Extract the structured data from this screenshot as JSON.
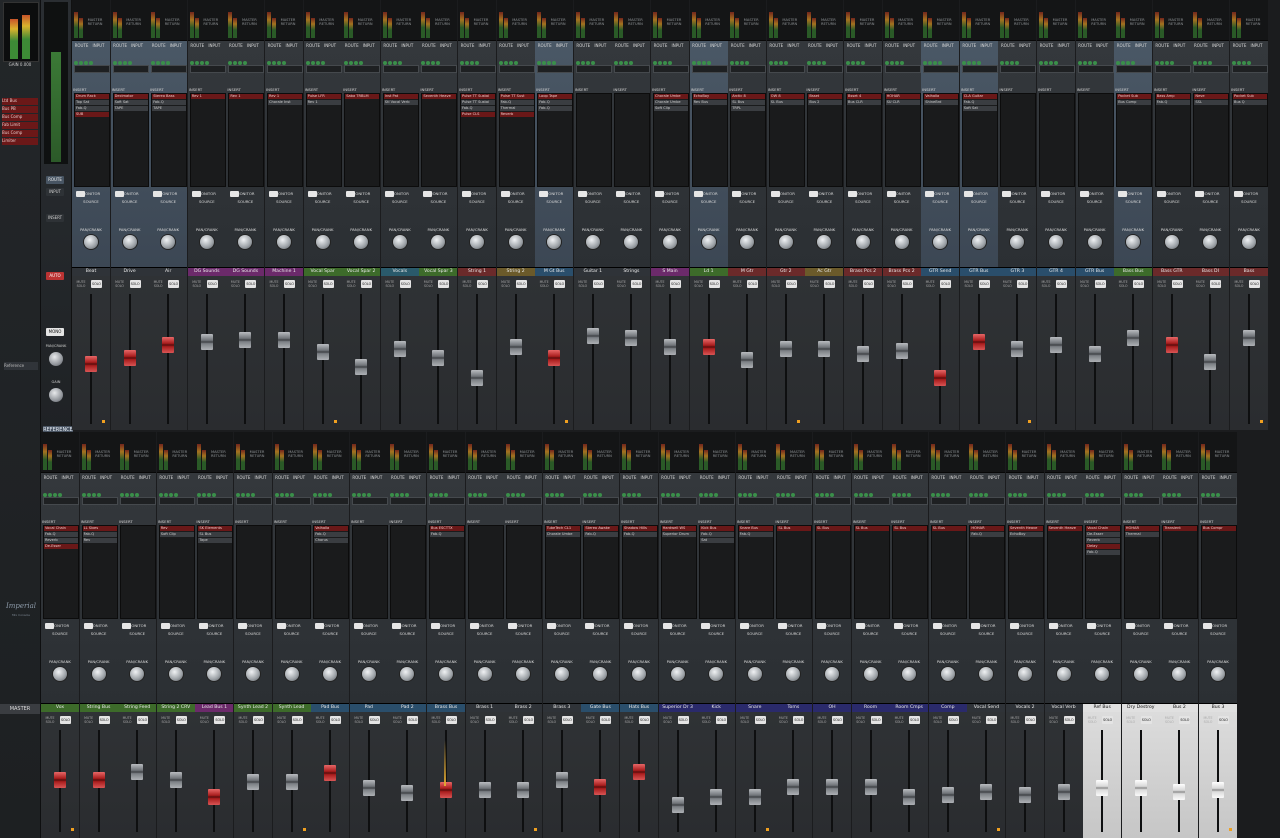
{
  "master": {
    "meter_labels": [
      "RMS",
      "AD"
    ],
    "gain_readout": "GAIN 0.000",
    "inserts": [
      "Ltd Bus",
      "Bus PB",
      "Bus Comp",
      "Fab Limit",
      "Bus Comp",
      "Limiter"
    ],
    "reference_text": "Reference",
    "label": "MASTER",
    "reference_tab": "REFERENCE"
  },
  "mid": {
    "buttons": [
      "ROUTE",
      "INPUT",
      "INSERT",
      "AUTO",
      "MONO"
    ],
    "pan_label": "PAN/CRANK",
    "gain_label": "GAIN"
  },
  "strip_labels": {
    "route": "ROUTE",
    "input": "INPUT",
    "insert": "INSERT",
    "monitor": "MONITOR",
    "source": "SOURCE",
    "pan": "PAN/CRANK",
    "solo": "SOLO",
    "mute": "MUTE SOLO",
    "master_return": "MASTER RETURN"
  },
  "top_tracks": [
    {
      "name": "Beat",
      "color": "#2f3338",
      "inserts": [
        "Drum Rack",
        "Top Sat",
        "Fab-Q",
        "SUB"
      ],
      "fader": "red",
      "fpos": 0.55,
      "blue": true
    },
    {
      "name": "Drive",
      "color": "#2f3338",
      "inserts": [
        "Decimator",
        "Soft Sat",
        "TAPE"
      ],
      "fader": "red",
      "fpos": 0.5,
      "blue": true
    },
    {
      "name": "Air",
      "color": "#2f3338",
      "inserts": [
        "Stereo Bass",
        "Fab-Q",
        "TAPE"
      ],
      "fader": "red",
      "fpos": 0.38,
      "blue": true
    },
    {
      "name": "DG Sounds",
      "color": "#6b2a6a",
      "inserts": [
        "Rev 1"
      ],
      "fader": "grey",
      "fpos": 0.36
    },
    {
      "name": "DG Sounds",
      "color": "#6b2a6a",
      "inserts": [
        "Rev 1"
      ],
      "fader": "grey",
      "fpos": 0.34
    },
    {
      "name": "Machine 1",
      "color": "#6b2a6a",
      "inserts": [
        "Rev 1",
        "Chorale Inst"
      ],
      "fader": "grey",
      "fpos": 0.34
    },
    {
      "name": "Vocal Spar",
      "color": "#3d6b2a",
      "inserts": [
        "Pulse LFR",
        "Rev 1"
      ],
      "fader": "grey",
      "fpos": 0.45
    },
    {
      "name": "Vocal Spar 2",
      "color": "#3d6b2a",
      "inserts": [
        "Saba TRBLM"
      ],
      "fader": "grey",
      "fpos": 0.58
    },
    {
      "name": "Vocals",
      "color": "#2a5a6b",
      "inserts": [
        "Inst Pat",
        "Stl Vocal Verb"
      ],
      "fader": "grey",
      "fpos": 0.42
    },
    {
      "name": "Vocal Spar 3",
      "color": "#3d6b2a",
      "inserts": [
        "Seventh Heave"
      ],
      "fader": "grey",
      "fpos": 0.5
    },
    {
      "name": "String 1",
      "color": "#6b2a2a",
      "inserts": [
        "Pulse TT Sustai",
        "Pulse TT Sustai",
        "Fab-Q",
        "Pulse CLS"
      ],
      "fader": "grey",
      "fpos": 0.68
    },
    {
      "name": "String 2",
      "color": "#6b5a2a",
      "inserts": [
        "Pulse TT Sust",
        "Fab-Q",
        "Thermal",
        "Reverb"
      ],
      "fader": "grey",
      "fpos": 0.4
    },
    {
      "name": "M Gt Bus",
      "color": "#2a4e6b",
      "inserts": [
        "Loop Tape",
        "Fab-Q",
        "Fab-Q"
      ],
      "fader": "red",
      "fpos": 0.5,
      "blue": true
    },
    {
      "name": "Guitar 1",
      "color": "#2f3338",
      "inserts": [],
      "fader": "grey",
      "fpos": 0.3
    },
    {
      "name": "Strings",
      "color": "#2f3338",
      "inserts": [],
      "fader": "grey",
      "fpos": 0.32
    },
    {
      "name": "S Main",
      "color": "#6b2a6a",
      "inserts": [
        "Chorale Umbe",
        "Chorale Umbe",
        "Soft Clip"
      ],
      "fader": "grey",
      "fpos": 0.4
    },
    {
      "name": "Ld 1",
      "color": "#3d6b2a",
      "inserts": [
        "EchoBoy",
        "Rev Bus"
      ],
      "fader": "red",
      "fpos": 0.4,
      "blue": true
    },
    {
      "name": "M Gtr",
      "color": "#6b2a2a",
      "inserts": [
        "Arctic 8",
        "SL Bus",
        "TRPL"
      ],
      "fader": "grey",
      "fpos": 0.52
    },
    {
      "name": "Gtr 2",
      "color": "#6b2a2a",
      "inserts": [
        "OW 8",
        "SL Bus"
      ],
      "fader": "grey",
      "fpos": 0.42
    },
    {
      "name": "Ac Gtr",
      "color": "#6b5a2a",
      "inserts": [
        "Bsset",
        "Bus 2"
      ],
      "fader": "grey",
      "fpos": 0.42
    },
    {
      "name": "Brass Pcs 2",
      "color": "#6b2a2a",
      "inserts": [
        "Bsset 4",
        "Bus CLR"
      ],
      "fader": "grey",
      "fpos": 0.46
    },
    {
      "name": "Brass Pcs 2",
      "color": "#6b2a2a",
      "inserts": [
        "HOHAR",
        "SU CLR"
      ],
      "fader": "grey",
      "fpos": 0.44
    },
    {
      "name": "GTR Send",
      "color": "#2a4e6b",
      "inserts": [
        "Valhalla",
        "ShineBrd"
      ],
      "fader": "red",
      "fpos": 0.68,
      "blue": true
    },
    {
      "name": "GTR Bus",
      "color": "#2a4e6b",
      "inserts": [
        "CLA Guitar",
        "Fab-Q",
        "Soft Sat"
      ],
      "fader": "red",
      "fpos": 0.36,
      "blue": true
    },
    {
      "name": "GTR 3",
      "color": "#2a4e6b",
      "inserts": [],
      "fader": "grey",
      "fpos": 0.42
    },
    {
      "name": "GTR 4",
      "color": "#2a4e6b",
      "inserts": [],
      "fader": "grey",
      "fpos": 0.38
    },
    {
      "name": "GTR Bus",
      "color": "#2a4e6b",
      "inserts": [],
      "fader": "grey",
      "fpos": 0.46
    },
    {
      "name": "Bass Bus",
      "color": "#3d6b2a",
      "inserts": [
        "Pocket Sub",
        "Bus Comp"
      ],
      "fader": "grey",
      "fpos": 0.32,
      "blue": true
    },
    {
      "name": "Bass GTR",
      "color": "#6b2a2a",
      "inserts": [
        "Bass Amp",
        "Fab-Q"
      ],
      "fader": "red",
      "fpos": 0.38
    },
    {
      "name": "Bass DI",
      "color": "#6b2a2a",
      "inserts": [
        "Neve",
        "SSL"
      ],
      "fader": "grey",
      "fpos": 0.54
    },
    {
      "name": "Bass",
      "color": "#6b2a2a",
      "inserts": [
        "Pocket Sub",
        "Bus Q"
      ],
      "fader": "grey",
      "fpos": 0.32
    }
  ],
  "bottom_tracks": [
    {
      "name": "Vox",
      "color": "#3d6b2a",
      "inserts": [
        "Vocal Chain",
        "Fab-Q",
        "Reverb",
        "De-Esser"
      ],
      "fader": "red",
      "fpos": 0.5
    },
    {
      "name": "String Bus",
      "color": "#3d6b2a",
      "inserts": [
        "LL Sixes",
        "Fab-Q",
        "Rev"
      ],
      "fader": "red",
      "fpos": 0.5
    },
    {
      "name": "String Feed",
      "color": "#3d6b2a",
      "inserts": [],
      "fader": "grey",
      "fpos": 0.4
    },
    {
      "name": "String 2 CRV",
      "color": "#3d6b2a",
      "inserts": [
        "Rev",
        "Soft Clip"
      ],
      "fader": "grey",
      "fpos": 0.5
    },
    {
      "name": "Lead Bus 1",
      "color": "#6b2a6a",
      "inserts": [
        "SK Elements",
        "SL Bus",
        "Tape"
      ],
      "fader": "red",
      "fpos": 0.7
    },
    {
      "name": "Synth Lead 2",
      "color": "#3d6b2a",
      "inserts": [],
      "fader": "grey",
      "fpos": 0.52
    },
    {
      "name": "Synth Lead",
      "color": "#3d6b2a",
      "inserts": [],
      "fader": "grey",
      "fpos": 0.52
    },
    {
      "name": "Pad Bus",
      "color": "#2a4e6b",
      "inserts": [
        "Valhalla",
        "Fab-Q",
        "Chorus"
      ],
      "fader": "red",
      "fpos": 0.42
    },
    {
      "name": "Pad",
      "color": "#2a4e6b",
      "inserts": [],
      "fader": "grey",
      "fpos": 0.6
    },
    {
      "name": "Pad 2",
      "color": "#2a4e6b",
      "inserts": [],
      "fader": "grey",
      "fpos": 0.66
    },
    {
      "name": "Brass Bus",
      "color": "#2a4e6b",
      "inserts": [
        "Bus ESCTTX",
        "Fab-Q"
      ],
      "fader": "red",
      "fpos": 0.62
    },
    {
      "name": "Brass 1",
      "color": "#2f3338",
      "inserts": [],
      "fader": "grey",
      "fpos": 0.62
    },
    {
      "name": "Brass 2",
      "color": "#2f3338",
      "inserts": [],
      "fader": "grey",
      "fpos": 0.62
    },
    {
      "name": "Brass 3",
      "color": "#2f3338",
      "inserts": [
        "TubeTech CL1",
        "Chorale Umbe"
      ],
      "fader": "grey",
      "fpos": 0.5
    },
    {
      "name": "Gate Bus",
      "color": "#2a4e6b",
      "inserts": [
        "Stereo Awake",
        "Fab-Q"
      ],
      "fader": "red",
      "fpos": 0.58
    },
    {
      "name": "Hats Bus",
      "color": "#2a4e6b",
      "inserts": [
        "Shadow Hills",
        "Fab-Q"
      ],
      "fader": "red",
      "fpos": 0.4
    },
    {
      "name": "Superior Dr 3",
      "color": "#2a2a6b",
      "inserts": [
        "Hardwell WS",
        "Superior Drum"
      ],
      "fader": "grey",
      "fpos": 0.8
    },
    {
      "name": "Kick",
      "color": "#2a2a6b",
      "inserts": [
        "Kick Bus",
        "Fab-Q",
        "Sat"
      ],
      "fader": "grey",
      "fpos": 0.7
    },
    {
      "name": "Snare",
      "color": "#2a2a6b",
      "inserts": [
        "Snare Bus",
        "Fab-Q"
      ],
      "fader": "grey",
      "fpos": 0.7
    },
    {
      "name": "Toms",
      "color": "#2a2a6b",
      "inserts": [
        "SL Bus"
      ],
      "fader": "grey",
      "fpos": 0.58
    },
    {
      "name": "OH",
      "color": "#2a2a6b",
      "inserts": [
        "SL Bus"
      ],
      "fader": "grey",
      "fpos": 0.58
    },
    {
      "name": "Room",
      "color": "#2a2a6b",
      "inserts": [
        "SL Bus"
      ],
      "fader": "grey",
      "fpos": 0.58
    },
    {
      "name": "Room Cmps",
      "color": "#2a2a6b",
      "inserts": [
        "SL Bus"
      ],
      "fader": "grey",
      "fpos": 0.7
    },
    {
      "name": "Comp",
      "color": "#2a2a6b",
      "inserts": [
        "SL Bus"
      ],
      "fader": "grey",
      "fpos": 0.68
    },
    {
      "name": "Vocal Send",
      "color": "#2f3338",
      "inserts": [
        "HOHAR",
        "Fab-Q"
      ],
      "fader": "grey",
      "fpos": 0.64
    },
    {
      "name": "Vocals 2",
      "color": "#2f3338",
      "inserts": [
        "Seventh Heave",
        "EchoBoy"
      ],
      "fader": "grey",
      "fpos": 0.68
    },
    {
      "name": "Vocal Verb",
      "color": "#2f3338",
      "inserts": [
        "Seventh Heave"
      ],
      "fader": "grey",
      "fpos": 0.64
    },
    {
      "name": "Ref Bus",
      "color": "#e0e0e0",
      "inserts": [
        "Vocal Chain",
        "De-Esser",
        "Reverb",
        "Delay",
        "Fab-Q"
      ],
      "fader": "white",
      "fpos": 0.6,
      "white": true
    },
    {
      "name": "Dry Destroy",
      "color": "#e0e0e0",
      "inserts": [
        "HOHAR",
        "Thermal"
      ],
      "fader": "white",
      "fpos": 0.6,
      "white": true
    },
    {
      "name": "Bus 2",
      "color": "#e0e0e0",
      "inserts": [
        "Transient"
      ],
      "fader": "white",
      "fpos": 0.64,
      "white": true
    },
    {
      "name": "Bus 3",
      "color": "#e0e0e0",
      "inserts": [
        "Bus Compr"
      ],
      "fader": "white",
      "fpos": 0.62,
      "white": true
    }
  ],
  "signature": {
    "script": "Imperial",
    "caption": "Mix Console"
  }
}
